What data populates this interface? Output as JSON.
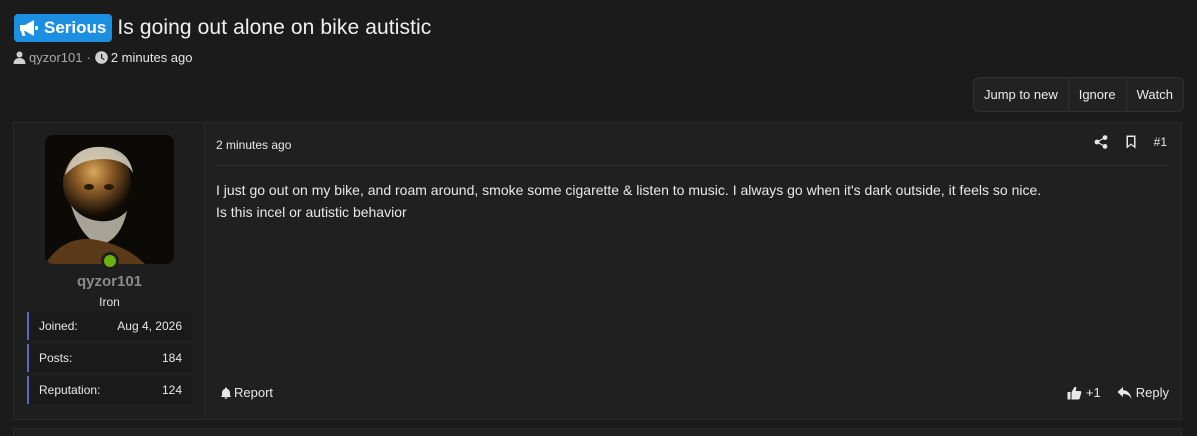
{
  "thread": {
    "prefix": "Serious",
    "prefix_color": "#1d8fe1",
    "title": "Is going out alone on bike autistic",
    "author": "qyzor101",
    "separator": "·",
    "time": "2 minutes ago"
  },
  "actions": {
    "jump_to_new": "Jump to new",
    "ignore": "Ignore",
    "watch": "Watch"
  },
  "post": {
    "user": {
      "name": "qyzor101",
      "rank": "Iron",
      "online": true,
      "online_color": "#6cb10f",
      "stats": [
        {
          "label": "Joined:",
          "value": "Aug 4, 2026"
        },
        {
          "label": "Posts:",
          "value": "184"
        },
        {
          "label": "Reputation:",
          "value": "124"
        }
      ]
    },
    "time": "2 minutes ago",
    "number": "#1",
    "body_lines": [
      "I just go out on my bike, and roam around, smoke some cigarette & listen to music. I always go when it's dark outside, it feels so nice.",
      "Is this incel or autistic behavior"
    ],
    "report_label": "Report",
    "reaction_count": "+1",
    "reply_label": "Reply"
  },
  "icons": {
    "prefix": "bullhorn-icon",
    "author": "user-icon",
    "time": "clock-icon",
    "share": "share-icon",
    "bookmark": "bookmark-icon",
    "report": "bell-icon",
    "like": "thumbs-up-icon",
    "reply": "reply-icon"
  }
}
